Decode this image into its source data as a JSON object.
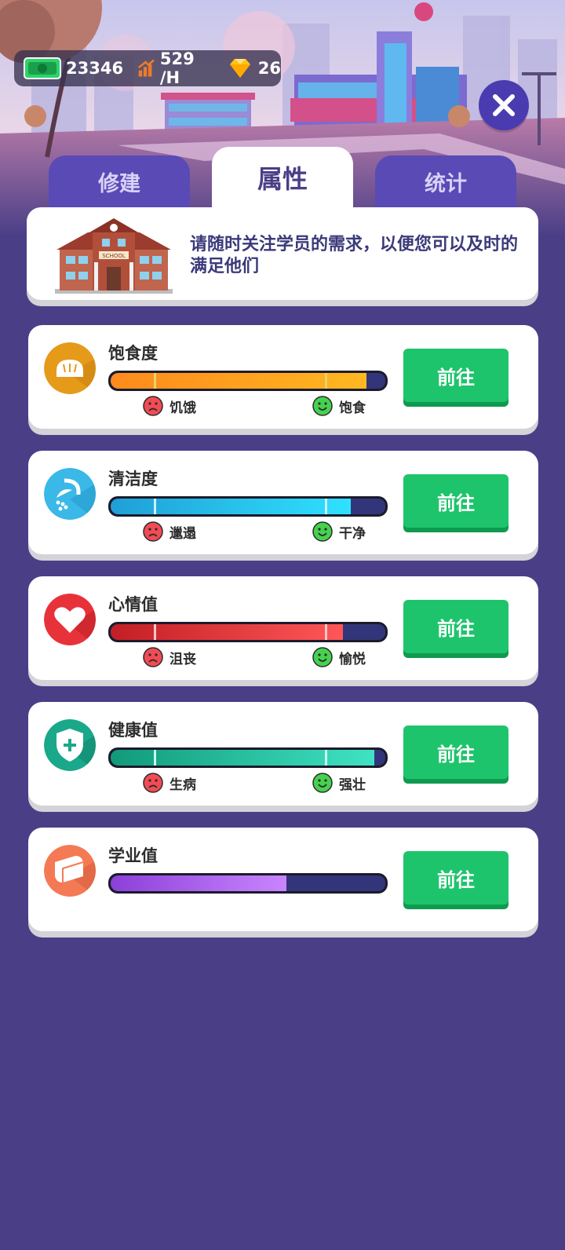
{
  "resources": {
    "cash": "23346",
    "income": "529 /H",
    "gems": "26"
  },
  "tabs": [
    {
      "label": "修建"
    },
    {
      "label": "属性"
    },
    {
      "label": "统计"
    }
  ],
  "info": {
    "school_sign": "SCHOOL",
    "text": "请随时关注学员的需求，以便您可以及时的满足他们"
  },
  "go_label": "前往",
  "stats": [
    {
      "name": "饱食度",
      "low": "饥饿",
      "high": "饱食",
      "value": 0.93,
      "color_from": "#ff8a1c",
      "color_to": "#ffb820",
      "tick": "#e9d36a"
    },
    {
      "name": "清洁度",
      "low": "邋遢",
      "high": "干净",
      "value": 0.875,
      "color_from": "#1f9fd6",
      "color_to": "#2fe1ff",
      "tick": "#c9f2ff"
    },
    {
      "name": "心情值",
      "low": "沮丧",
      "high": "愉悦",
      "value": 0.845,
      "color_from": "#c31e25",
      "color_to": "#ff5757",
      "tick": "#ffc7c7"
    },
    {
      "name": "健康值",
      "low": "生病",
      "high": "强壮",
      "value": 0.96,
      "color_from": "#119a7a",
      "color_to": "#3fe3c3",
      "tick": "#c8ffef"
    },
    {
      "name": "学业值",
      "value": 0.64,
      "color_from": "#8b40d8",
      "color_to": "#c985ff"
    }
  ]
}
